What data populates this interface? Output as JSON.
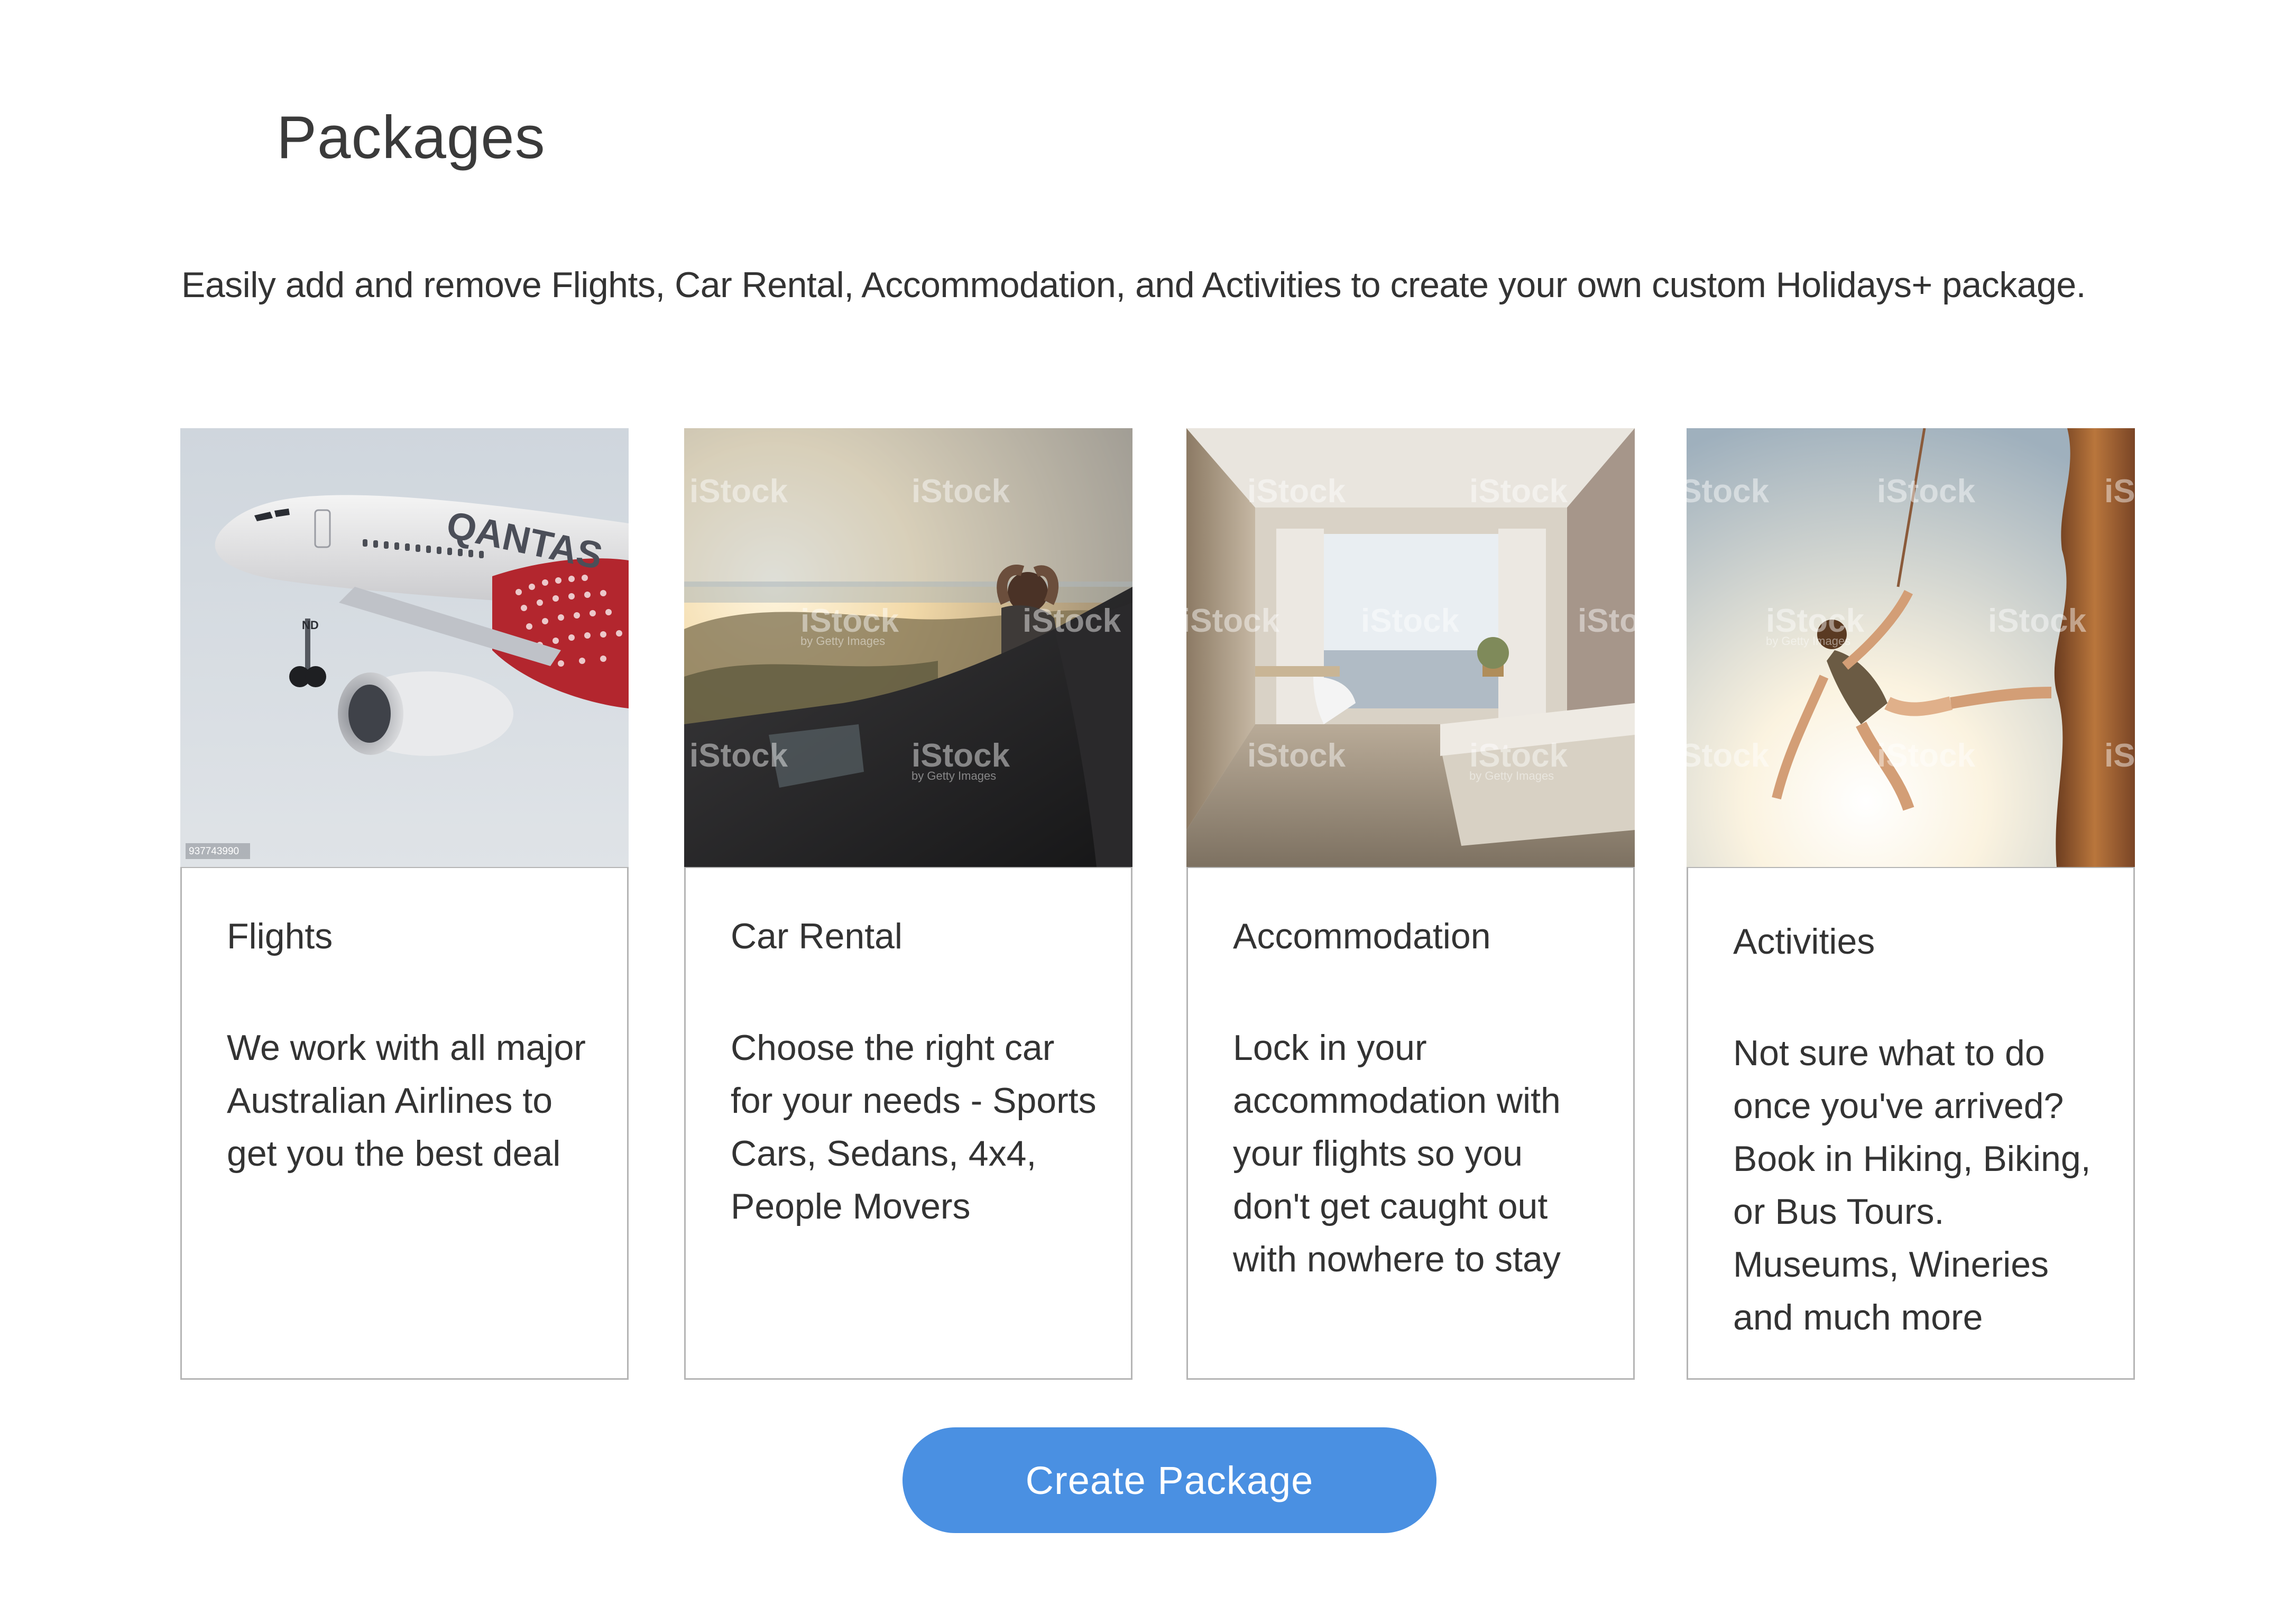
{
  "page": {
    "title": "Packages",
    "intro": "Easily add and remove Flights, Car Rental, Accommodation, and Activities to create your own custom Holidays+ package."
  },
  "cards": [
    {
      "title": "Flights",
      "description": "We work with all major Australian Airlines to get you the best deal",
      "image": "airplane-photo",
      "image_text": {
        "livery": "QANTAS",
        "reg": "ND",
        "stock_id": "937743990"
      }
    },
    {
      "title": "Car Rental",
      "description": "Choose the right car for your needs - Sports Cars, Sedans, 4x4, People Movers",
      "image": "road-trip-photo",
      "image_text": {
        "watermark": "iStock",
        "watermark_sub": "by Getty Images"
      }
    },
    {
      "title": "Accommodation",
      "description": "Lock in your accommodation with your flights so you don't get caught out with nowhere to stay",
      "image": "hotel-room-photo",
      "image_text": {
        "watermark": "iStock",
        "watermark_sub": "by Getty Images"
      }
    },
    {
      "title": "Activities",
      "description": "Not sure what to do once you've arrived? Book in Hiking, Biking, or Bus Tours. Museums, Wineries and much more",
      "image": "rock-climbing-photo",
      "image_text": {
        "watermark": "iStock",
        "watermark_sub": "by Getty Images"
      }
    }
  ],
  "cta": {
    "label": "Create Package",
    "color": "#4a90e2"
  },
  "colors": {
    "text": "#333333",
    "card_border": "#b5b5b5",
    "background": "#ffffff"
  }
}
